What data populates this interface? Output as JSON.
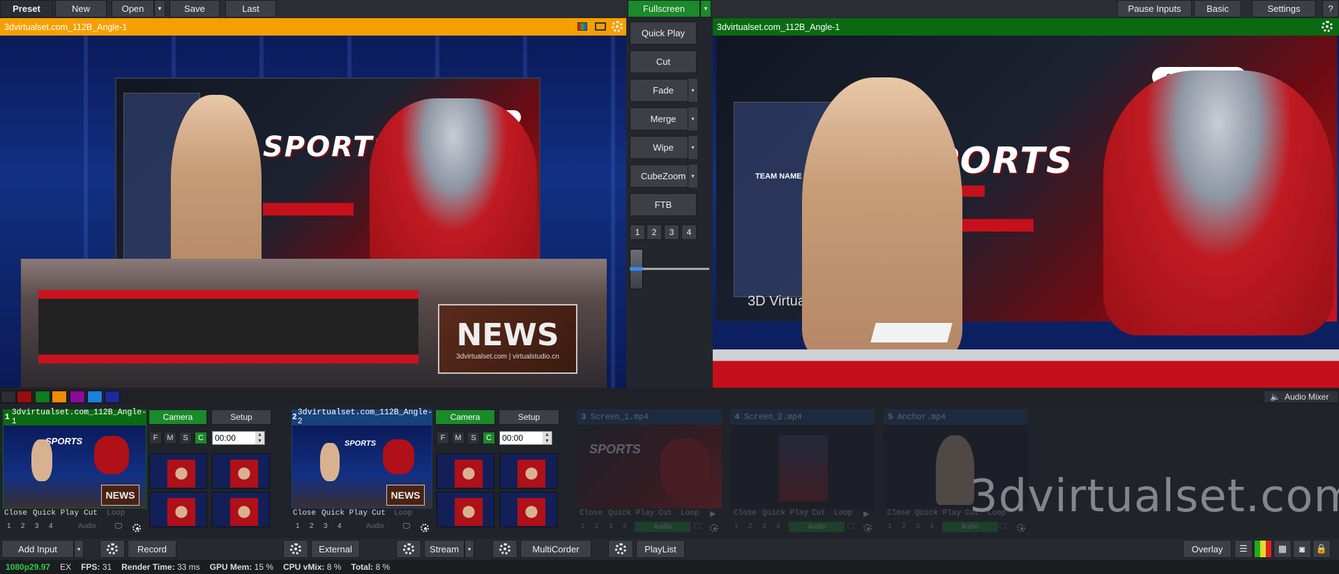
{
  "topbar": {
    "preset": "Preset",
    "new": "New",
    "open": "Open",
    "save": "Save",
    "last": "Last",
    "fullscreen": "Fullscreen",
    "pause_inputs": "Pause Inputs",
    "basic": "Basic",
    "settings": "Settings",
    "help": "?"
  },
  "preview": {
    "title": "3dvirtualset.com_112B_Angle-1",
    "color": "#f5a000"
  },
  "output": {
    "title": "3dvirtualset.com_112B_Angle-1",
    "color": "#0a6a12"
  },
  "scene_text": {
    "sports": "SPORTS",
    "news": "NEWS",
    "news_side": "SPORTS",
    "news_sub": "3dvirtualset.com | virtualstudio.cn",
    "watermark_badge": "3dvirtualset.com",
    "set_label": "3D Virtual Set",
    "team_name": "TEAM NAME"
  },
  "transitions": {
    "quick_play": "Quick Play",
    "cut": "Cut",
    "fade": "Fade",
    "merge": "Merge",
    "wipe": "Wipe",
    "cubezoom": "CubeZoom",
    "ftb": "FTB",
    "numbers": [
      "1",
      "2",
      "3",
      "4"
    ]
  },
  "color_swatches": [
    "#2b2d33",
    "#9a0d0d",
    "#0f7a1e",
    "#f08a00",
    "#8a0d96",
    "#1a7fe0",
    "#1c2a9a"
  ],
  "audio_mixer": "Audio Mixer",
  "inputs": [
    {
      "num": "1",
      "title": "3dvirtualset.com_112B_Angle-1",
      "camera": "Camera",
      "setup": "Setup",
      "time": "00:00",
      "fmsc": [
        "F",
        "M",
        "S",
        "C"
      ],
      "actions": [
        "Close",
        "Quick Play",
        "Cut",
        "Loop"
      ],
      "subs": [
        "1",
        "2",
        "3",
        "4",
        "Audio"
      ]
    },
    {
      "num": "2",
      "title": "3dvirtualset.com_112B_Angle-2",
      "camera": "Camera",
      "setup": "Setup",
      "time": "00:00",
      "fmsc": [
        "F",
        "M",
        "S",
        "C"
      ],
      "actions": [
        "Close",
        "Quick Play",
        "Cut",
        "Loop"
      ],
      "subs": [
        "1",
        "2",
        "3",
        "4",
        "Audio"
      ]
    },
    {
      "num": "3",
      "title": "Screen_1.mp4",
      "actions": [
        "Close",
        "Quick Play",
        "Cut",
        "Loop"
      ],
      "subs": [
        "1",
        "2",
        "3",
        "4",
        "Audio"
      ]
    },
    {
      "num": "4",
      "title": "Screen_2.mp4",
      "actions": [
        "Close",
        "Quick Play",
        "Cut",
        "Loop"
      ],
      "subs": [
        "1",
        "2",
        "3",
        "4",
        "Audio"
      ]
    },
    {
      "num": "5",
      "title": "Anchor.mp4",
      "actions": [
        "Close",
        "Quick Play",
        "Cut",
        "Loop"
      ],
      "subs": [
        "1",
        "2",
        "3",
        "4",
        "Audio"
      ]
    }
  ],
  "watermark": "3dvirtualset.com",
  "bottombar": {
    "add_input": "Add Input",
    "record": "Record",
    "external": "External",
    "stream": "Stream",
    "multicorder": "MultiCorder",
    "playlist": "PlayList",
    "overlay": "Overlay"
  },
  "status": {
    "format": "1080p29.97",
    "ex": "EX",
    "fps_label": "FPS:",
    "fps": "31",
    "render_label": "Render Time:",
    "render": "33 ms",
    "gpu_label": "GPU Mem:",
    "gpu": "15 %",
    "cpu_label": "CPU vMix:",
    "cpu": "8 %",
    "total_label": "Total:",
    "total": "8 %"
  }
}
